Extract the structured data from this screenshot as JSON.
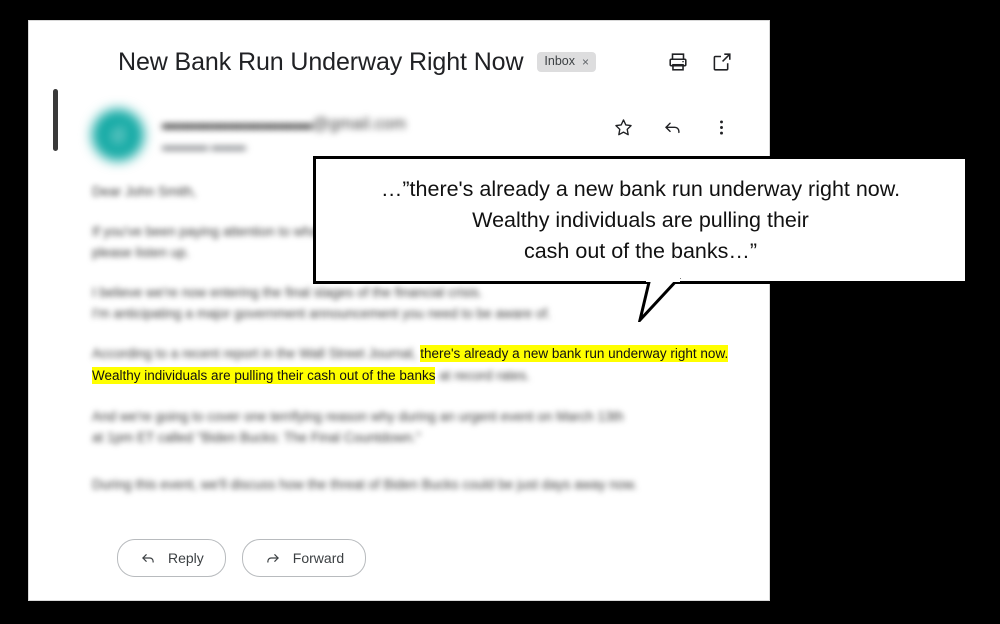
{
  "window": {
    "background_color": "#000000",
    "card_background": "#ffffff"
  },
  "header": {
    "subject": "New Bank Run Underway Right Now",
    "label_chip": "Inbox",
    "label_chip_close": "×",
    "print_icon": "print-icon",
    "open_in_new_icon": "open-in-new-window-icon"
  },
  "sender": {
    "avatar_letter": "d",
    "avatar_color": "#12a9a4",
    "email_redacted": "▬▬▬▬▬▬▬▬▬@gmail.com",
    "meta_redacted": "▬▬▬▬ ▬▬▬",
    "star_icon": "star-icon",
    "reply_icon": "reply-arrow-icon",
    "more_icon": "more-vertical-icon"
  },
  "body": {
    "paragraphs": [
      "Dear John Smith,",
      "If you've been paying attention to what's happening in the markets lately,\nplease listen up.",
      "I believe we're now entering the final stages of the financial crisis.\nI'm anticipating a major government announcement you need to be aware of.",
      "And we're going to cover one terrifying reason why during an urgent event on March 13th\nat 1pm ET called \"Biden Bucks: The Final Countdown.\"",
      "During this event, we'll discuss how the threat of Biden Bucks could be just days away now."
    ],
    "highlight_paragraph": {
      "lead_redacted": "According to a recent report in the Wall Street Journal,",
      "highlighted": "there's already a new bank run underway right now. Wealthy individuals are pulling their cash out of the banks",
      "trail_redacted": "at record rates.",
      "highlight_color": "#ffff00"
    }
  },
  "actions": {
    "reply_label": "Reply",
    "reply_icon": "reply-arrow-icon",
    "forward_label": "Forward",
    "forward_icon": "forward-arrow-icon"
  },
  "callout": {
    "text": "…”there's already a new bank run underway right now.\nWealthy individuals are pulling their\ncash out of the banks…”",
    "border_color": "#000000",
    "background_color": "#ffffff"
  }
}
